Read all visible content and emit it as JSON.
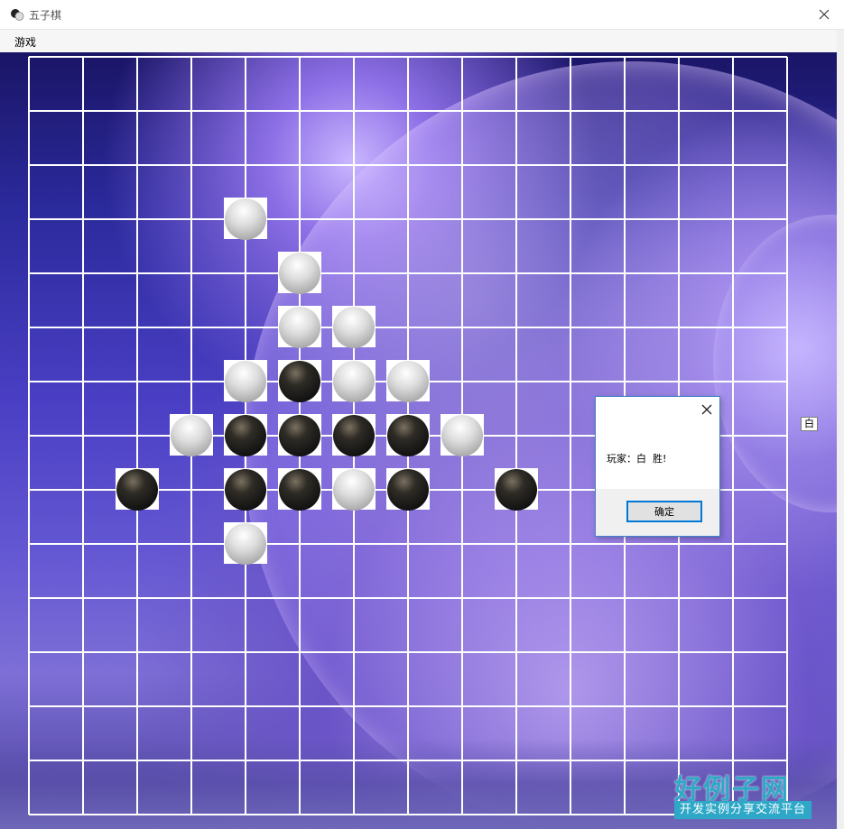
{
  "window": {
    "title": "五子棋",
    "close_glyph": "✕"
  },
  "menu": {
    "items": [
      "游戏"
    ]
  },
  "board": {
    "cols": 14,
    "rows": 14,
    "line_color": "#ffffff",
    "stones": [
      {
        "color": "white",
        "col": 4,
        "row": 3
      },
      {
        "color": "white",
        "col": 5,
        "row": 4
      },
      {
        "color": "white",
        "col": 5,
        "row": 5
      },
      {
        "color": "white",
        "col": 6,
        "row": 5
      },
      {
        "color": "white",
        "col": 4,
        "row": 6
      },
      {
        "color": "black",
        "col": 5,
        "row": 6
      },
      {
        "color": "white",
        "col": 6,
        "row": 6
      },
      {
        "color": "white",
        "col": 7,
        "row": 6
      },
      {
        "color": "white",
        "col": 3,
        "row": 7
      },
      {
        "color": "black",
        "col": 4,
        "row": 7
      },
      {
        "color": "black",
        "col": 5,
        "row": 7
      },
      {
        "color": "black",
        "col": 6,
        "row": 7
      },
      {
        "color": "black",
        "col": 7,
        "row": 7
      },
      {
        "color": "white",
        "col": 8,
        "row": 7
      },
      {
        "color": "black",
        "col": 2,
        "row": 8
      },
      {
        "color": "black",
        "col": 4,
        "row": 8
      },
      {
        "color": "black",
        "col": 5,
        "row": 8
      },
      {
        "color": "white",
        "col": 6,
        "row": 8
      },
      {
        "color": "black",
        "col": 7,
        "row": 8
      },
      {
        "color": "black",
        "col": 9,
        "row": 8
      },
      {
        "color": "white",
        "col": 4,
        "row": 9
      }
    ]
  },
  "side_label": "白",
  "dialog": {
    "message": "玩家：白  胜!",
    "ok_label": "确定"
  },
  "watermark": {
    "main": "好例子网",
    "sub": "开发实例分享交流平台"
  }
}
